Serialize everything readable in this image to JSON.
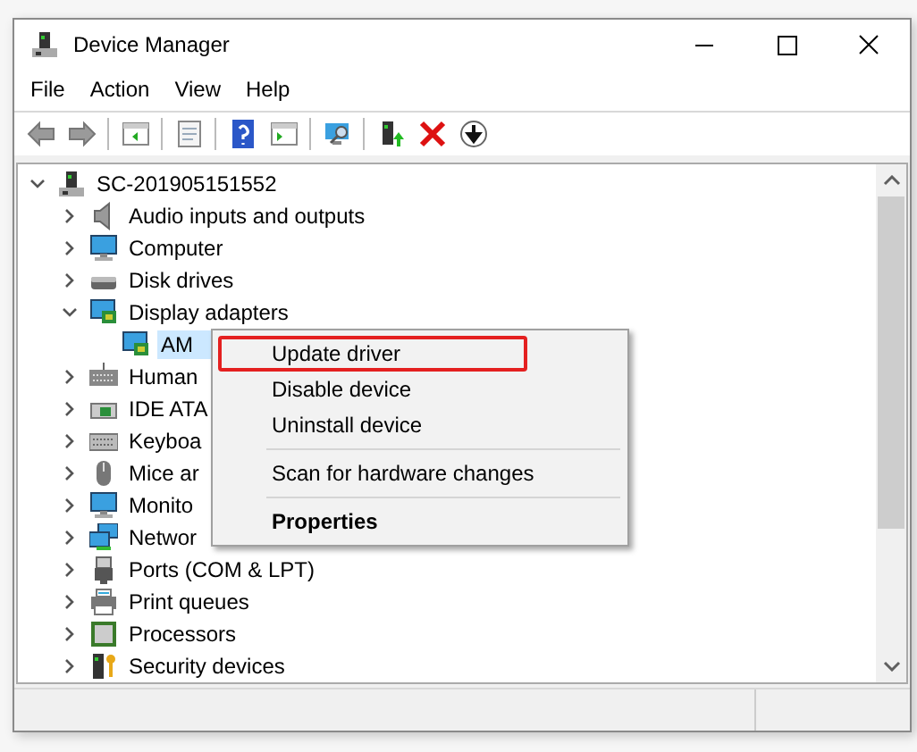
{
  "window": {
    "title": "Device Manager"
  },
  "menu": [
    "File",
    "Action",
    "View",
    "Help"
  ],
  "tree": {
    "label": "SC-201905151552",
    "expanded": true,
    "children": [
      {
        "label": "Audio inputs and outputs",
        "expanded": false
      },
      {
        "label": "Computer",
        "expanded": false
      },
      {
        "label": "Disk drives",
        "expanded": false
      },
      {
        "label": "Display adapters",
        "expanded": true,
        "children": [
          {
            "label": "AM",
            "selected": true
          }
        ]
      },
      {
        "label": "Human",
        "expanded": false
      },
      {
        "label": "IDE ATA",
        "expanded": false
      },
      {
        "label": "Keyboa",
        "expanded": false
      },
      {
        "label": "Mice ar",
        "expanded": false
      },
      {
        "label": "Monito",
        "expanded": false
      },
      {
        "label": "Networ",
        "expanded": false
      },
      {
        "label": "Ports (COM & LPT)",
        "expanded": false
      },
      {
        "label": "Print queues",
        "expanded": false
      },
      {
        "label": "Processors",
        "expanded": false
      },
      {
        "label": "Security devices",
        "expanded": false
      }
    ]
  },
  "context_menu": [
    {
      "kind": "item",
      "label": "Update driver",
      "highlighted": true
    },
    {
      "kind": "item",
      "label": "Disable device",
      "highlighted": false
    },
    {
      "kind": "item",
      "label": "Uninstall device",
      "highlighted": false
    },
    {
      "kind": "separator"
    },
    {
      "kind": "item",
      "label": "Scan for hardware changes",
      "highlighted": false
    },
    {
      "kind": "separator"
    },
    {
      "kind": "default",
      "label": "Properties",
      "highlighted": false
    }
  ]
}
